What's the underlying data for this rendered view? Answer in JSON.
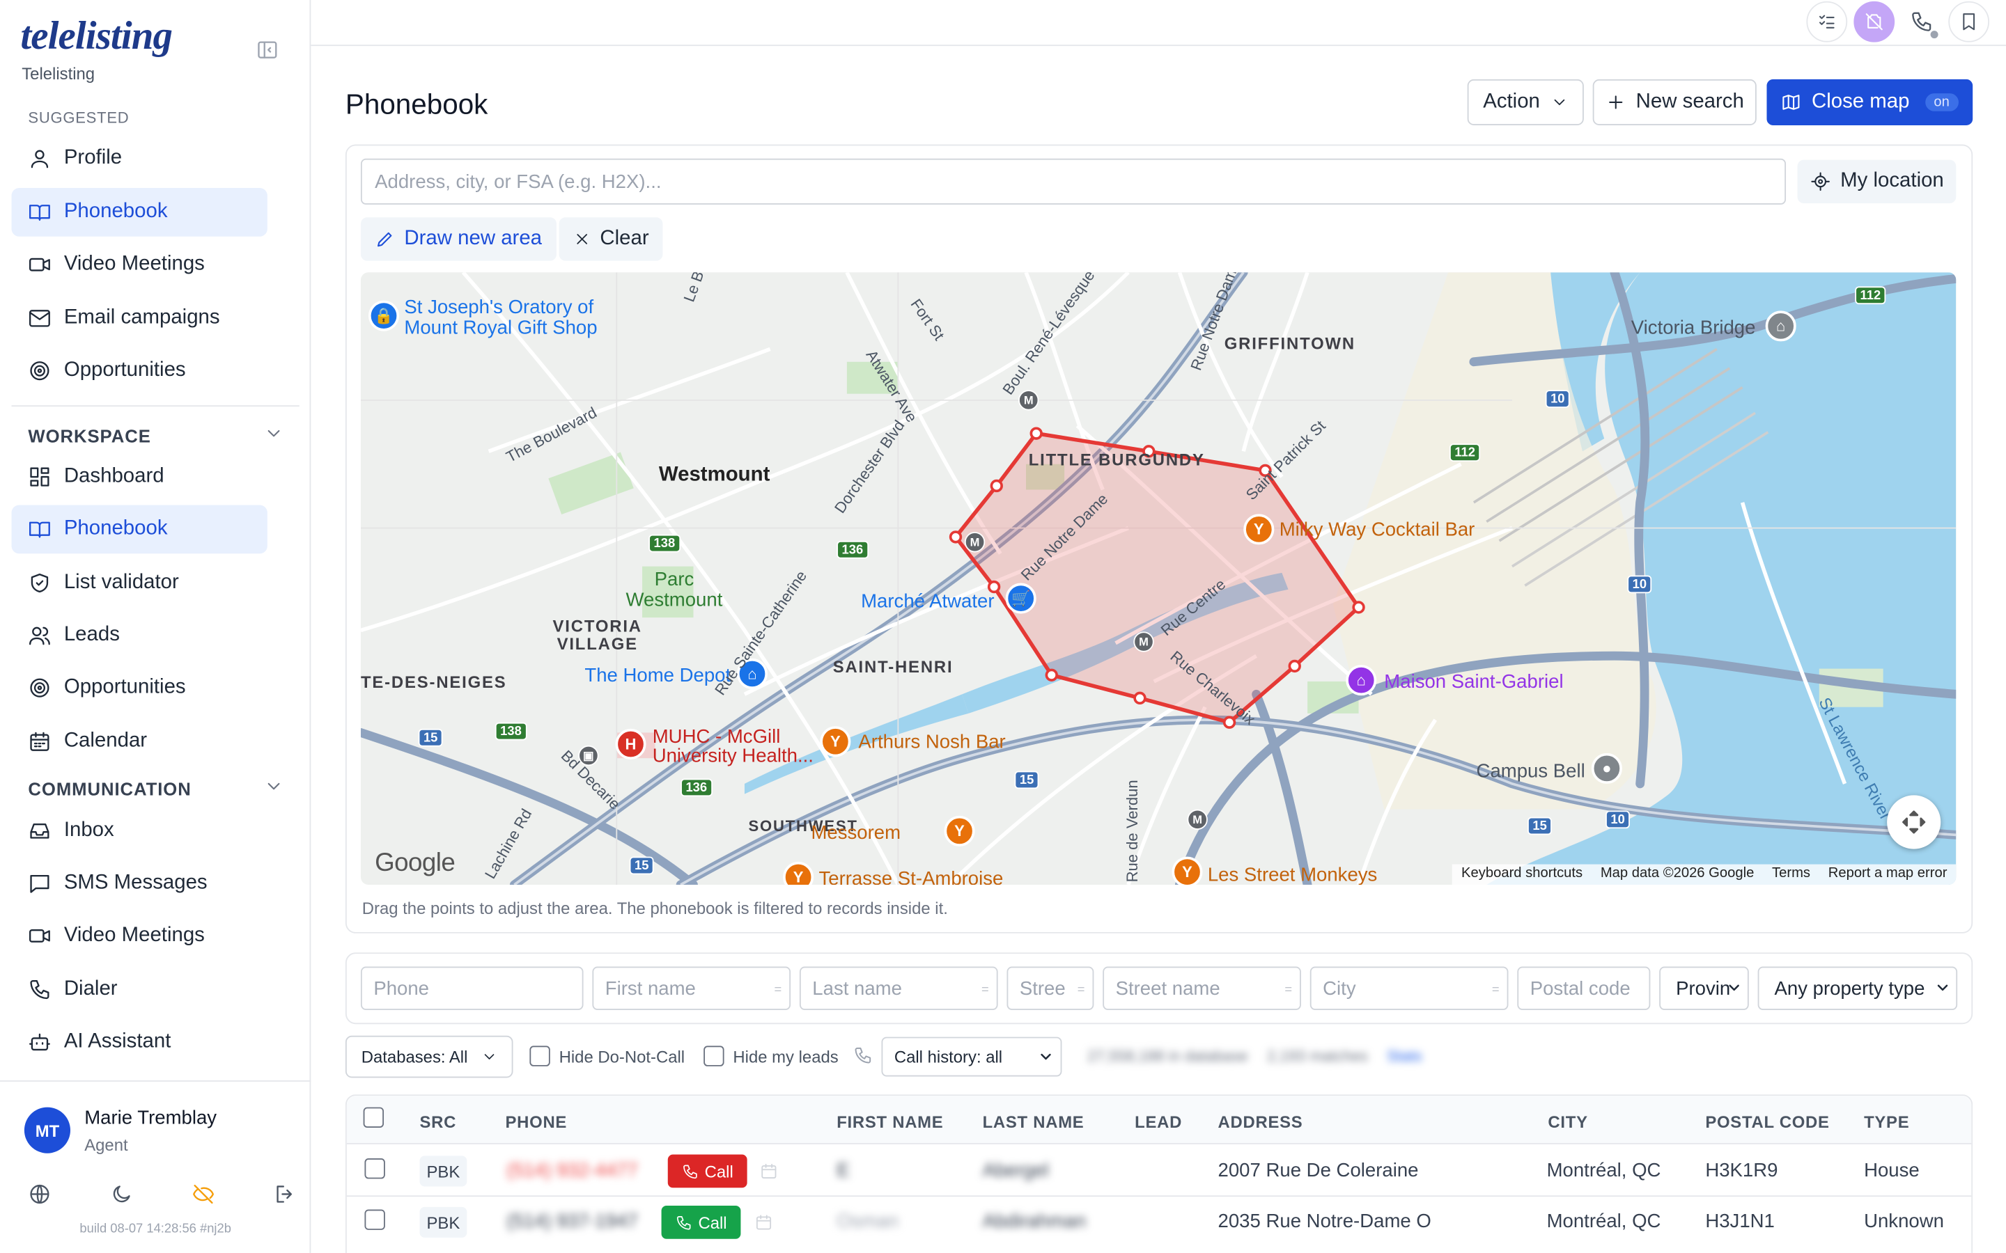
{
  "brand": {
    "logo": "telelisting",
    "name": "Telelisting"
  },
  "sidebar": {
    "suggested_label": "SUGGESTED",
    "suggested": [
      {
        "label": "Profile",
        "icon": "user-icon"
      },
      {
        "label": "Phonebook",
        "icon": "book-icon",
        "active": true
      },
      {
        "label": "Video Meetings",
        "icon": "video-icon"
      },
      {
        "label": "Email campaigns",
        "icon": "mail-icon"
      },
      {
        "label": "Opportunities",
        "icon": "target-icon"
      }
    ],
    "workspace_label": "WORKSPACE",
    "workspace": [
      {
        "label": "Dashboard",
        "icon": "dashboard-icon"
      },
      {
        "label": "Phonebook",
        "icon": "book-icon",
        "active": true
      },
      {
        "label": "List validator",
        "icon": "shield-check-icon"
      },
      {
        "label": "Leads",
        "icon": "users-icon"
      },
      {
        "label": "Opportunities",
        "icon": "target-icon"
      },
      {
        "label": "Calendar",
        "icon": "calendar-icon"
      }
    ],
    "communication_label": "COMMUNICATION",
    "communication": [
      {
        "label": "Inbox",
        "icon": "inbox-icon"
      },
      {
        "label": "SMS Messages",
        "icon": "message-icon"
      },
      {
        "label": "Video Meetings",
        "icon": "video-icon"
      },
      {
        "label": "Dialer",
        "icon": "phone-icon"
      },
      {
        "label": "AI Assistant",
        "icon": "bot-icon"
      }
    ],
    "user": {
      "initials": "MT",
      "name": "Marie Tremblay",
      "role": "Agent"
    },
    "build": "build 08-07 14:28:56 #nj2b"
  },
  "header": {
    "title": "Phonebook",
    "action_label": "Action",
    "new_search_label": "New search",
    "close_map_label": "Close map",
    "close_map_badge": "on"
  },
  "map_panel": {
    "address_placeholder": "Address, city, or FSA (e.g. H2X)...",
    "my_location_label": "My location",
    "draw_label": "Draw new area",
    "clear_label": "Clear",
    "hint": "Drag the points to adjust the area. The phonebook is filtered to records inside it.",
    "labels": {
      "westmount": "Westmount",
      "little_burgundy": "LITTLE BURGUNDY",
      "griffintown": "GRIFFINTOWN",
      "saint_henri": "SAINT-HENRI",
      "victoria_village": "VICTORIA VILLAGE",
      "cote_des_neiges": "TE-DES-NEIGES",
      "southwest": "SOUTHWEST",
      "parc_westmount": "Parc Westmount",
      "st_joseph": "St Joseph's Oratory of Mount Royal Gift Shop",
      "victoria_bridge": "Victoria Bridge",
      "milky_way": "Milky Way Cocktail Bar",
      "marche_atwater": "Marché Atwater",
      "home_depot": "The Home Depot",
      "maison_saint_gabriel": "Maison Saint-Gabriel",
      "muhc": "MUHC - McGill University Health...",
      "arthurs": "Arthurs Nosh Bar",
      "campus_bell": "Campus Bell",
      "messorem": "Messorem",
      "terrasse": "Terrasse St-Ambroise",
      "les_street_monkeys": "Les Street Monkeys",
      "st_lawrence": "St Lawrence River",
      "the_boulevard": "The Boulevard",
      "atwater_ave": "Atwater Ave",
      "dorchester": "Dorchester Blvd",
      "fort_st": "Fort St",
      "rene_levesque": "Boul. René-Lévesque",
      "rue_notre_dame_n": "Rue Notre Dam",
      "rue_notre_dame": "Rue Notre Dame",
      "rue_centre": "Rue Centre",
      "rue_charlevoix": "Rue Charlevoix",
      "saint_patrick": "Saint Patrick St",
      "rue_ste_catherine": "Rue Sainte-Catherine",
      "bd_decarie": "Bd Decarie",
      "lachine_rd": "Lachine Rd",
      "rue_de_verdun": "Rue de Verdun",
      "le_b": "Le B"
    },
    "shields": [
      "112",
      "10",
      "112",
      "138",
      "136",
      "10",
      "138",
      "15",
      "138",
      "136",
      "15",
      "10",
      "15",
      "15"
    ],
    "footer": {
      "shortcuts": "Keyboard shortcuts",
      "data": "Map data ©2026 Google",
      "terms": "Terms",
      "report": "Report a map error"
    },
    "google": "Google"
  },
  "filters": {
    "phone": "Phone",
    "first_name": "First name",
    "last_name": "Last name",
    "street_no": "Stree",
    "street_name": "Street name",
    "city": "City",
    "postal_code": "Postal code",
    "province": "Provin",
    "property_type": "Any property type",
    "databases": "Databases: All",
    "hide_dnc": "Hide Do-Not-Call",
    "hide_leads": "Hide my leads",
    "call_history": "Call history: all",
    "count_db": "27,558,188 in database",
    "count_matches": "2,193 matches",
    "stats": "Stats"
  },
  "table": {
    "columns": [
      "SRC",
      "PHONE",
      "FIRST NAME",
      "LAST NAME",
      "LEAD",
      "ADDRESS",
      "CITY",
      "POSTAL CODE",
      "TYPE"
    ],
    "call_label": "Call",
    "rows": [
      {
        "src": "PBK",
        "phone": "(514) 932-4477",
        "first": "E",
        "last": "Abergel",
        "address": "2007 Rue De Coleraine",
        "city": "Montréal, QC",
        "postal": "H3K1R9",
        "type": "House",
        "call_color": "#dc2626"
      },
      {
        "src": "PBK",
        "phone": "(514) 937-1947",
        "first": "Osman",
        "last": "Abdirahman",
        "address": "2035 Rue Notre-Dame O",
        "city": "Montréal, QC",
        "postal": "H3J1N1",
        "type": "Unknown",
        "call_color": "#16a34a"
      }
    ]
  }
}
